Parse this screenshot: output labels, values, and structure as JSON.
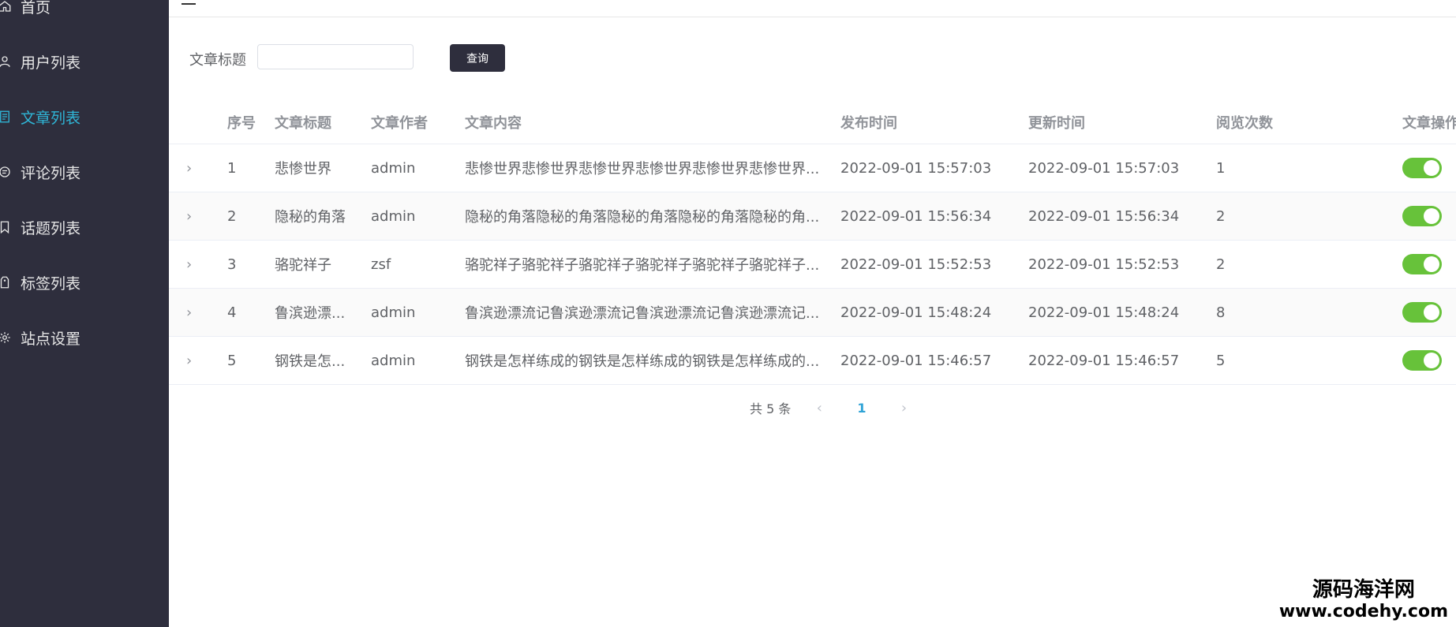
{
  "sidebar": {
    "items": [
      {
        "label": "首页",
        "icon": "home-icon"
      },
      {
        "label": "用户列表",
        "icon": "user-icon"
      },
      {
        "label": "文章列表",
        "icon": "document-icon",
        "active": true
      },
      {
        "label": "评论列表",
        "icon": "comment-icon"
      },
      {
        "label": "话题列表",
        "icon": "bookmark-icon"
      },
      {
        "label": "标签列表",
        "icon": "tag-icon"
      },
      {
        "label": "站点设置",
        "icon": "gear-icon"
      }
    ]
  },
  "search": {
    "label": "文章标题",
    "value": "",
    "button_label": "查询"
  },
  "table": {
    "headers": [
      "序号",
      "文章标题",
      "文章作者",
      "文章内容",
      "发布时间",
      "更新时间",
      "阅览次数",
      "文章操作"
    ],
    "rows": [
      {
        "id": "1",
        "title": "悲惨世界",
        "author": "admin",
        "content": "悲惨世界悲惨世界悲惨世界悲惨世界悲惨世界悲惨世界...",
        "published": "2022-09-01 15:57:03",
        "updated": "2022-09-01 15:57:03",
        "views": "1",
        "enabled": true
      },
      {
        "id": "2",
        "title": "隐秘的角落",
        "author": "admin",
        "content": "隐秘的角落隐秘的角落隐秘的角落隐秘的角落隐秘的角...",
        "published": "2022-09-01 15:56:34",
        "updated": "2022-09-01 15:56:34",
        "views": "2",
        "enabled": true
      },
      {
        "id": "3",
        "title": "骆驼祥子",
        "author": "zsf",
        "content": "骆驼祥子骆驼祥子骆驼祥子骆驼祥子骆驼祥子骆驼祥子...",
        "published": "2022-09-01 15:52:53",
        "updated": "2022-09-01 15:52:53",
        "views": "2",
        "enabled": true
      },
      {
        "id": "4",
        "title": "鲁滨逊漂...",
        "author": "admin",
        "content": "鲁滨逊漂流记鲁滨逊漂流记鲁滨逊漂流记鲁滨逊漂流记...",
        "published": "2022-09-01 15:48:24",
        "updated": "2022-09-01 15:48:24",
        "views": "8",
        "enabled": true
      },
      {
        "id": "5",
        "title": "钢铁是怎...",
        "author": "admin",
        "content": "钢铁是怎样练成的钢铁是怎样练成的钢铁是怎样练成的...",
        "published": "2022-09-01 15:46:57",
        "updated": "2022-09-01 15:46:57",
        "views": "5",
        "enabled": true
      }
    ]
  },
  "pagination": {
    "total_text": "共 5 条",
    "current_page": "1"
  },
  "watermark": {
    "line1": "源码海洋网",
    "line2": "www.codehy.com"
  },
  "colors": {
    "sidebar_bg": "#2e2e3d",
    "active": "#2fb5d6",
    "switch_on": "#67c23a"
  }
}
